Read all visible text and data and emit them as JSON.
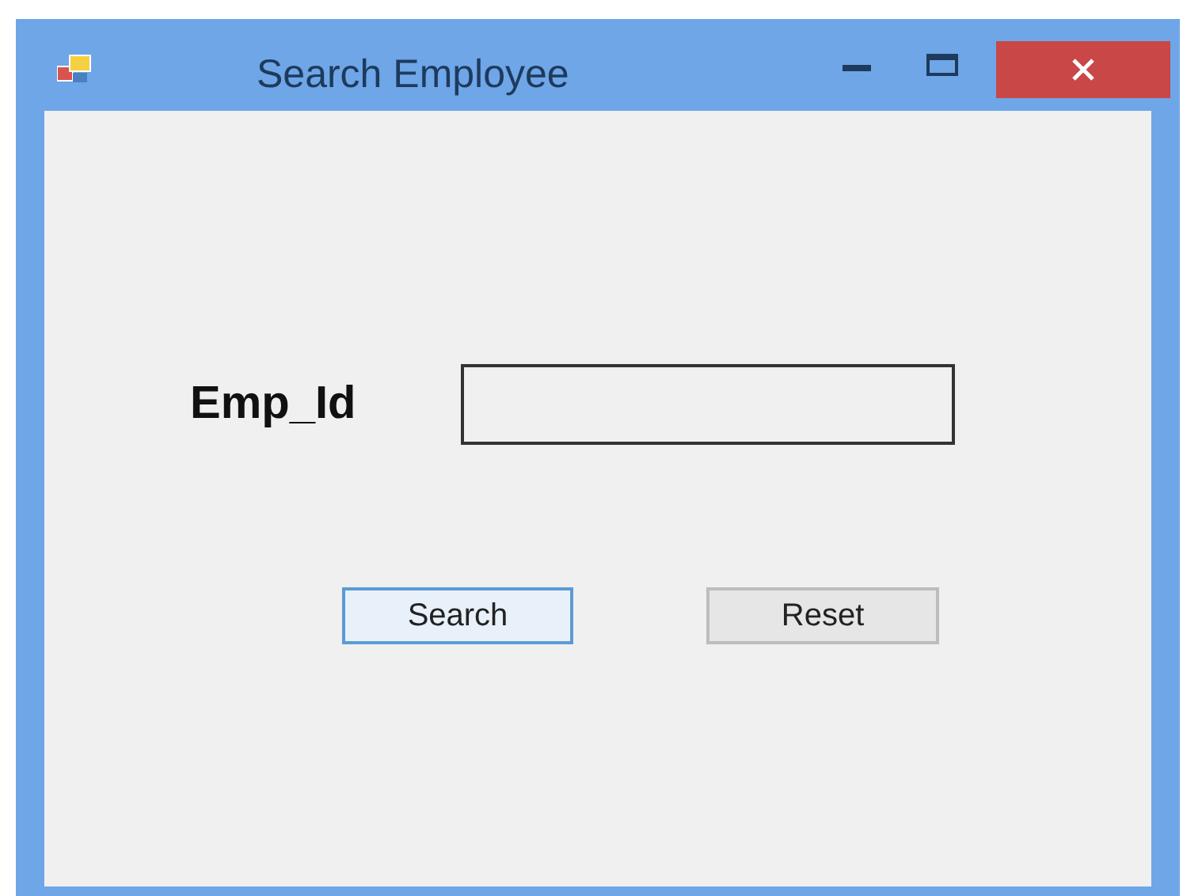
{
  "window": {
    "title": "Search Employee"
  },
  "form": {
    "label": "Emp_Id"
  },
  "buttons": [
    {
      "label": "Search",
      "focused": true
    },
    {
      "label": "Reset",
      "focused": false
    }
  ]
}
